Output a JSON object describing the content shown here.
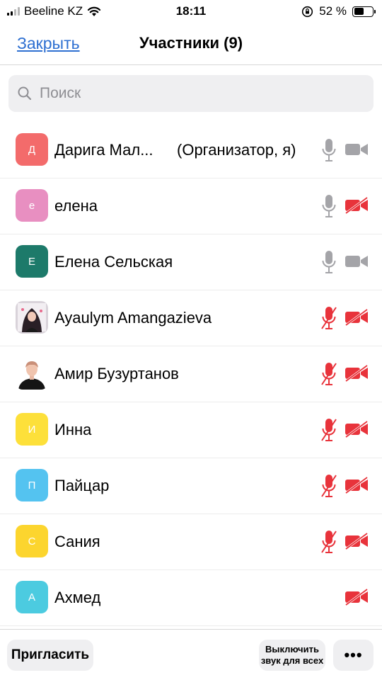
{
  "status_bar": {
    "carrier": "Beeline KZ",
    "time": "18:11",
    "battery": "52 %",
    "battery_level": 0.52
  },
  "nav": {
    "close_label": "Закрыть",
    "title": "Участники (9)"
  },
  "search": {
    "placeholder": "Поиск"
  },
  "colors": {
    "accent": "#2d6fd1",
    "muted_red": "#e8333b",
    "icon_gray": "#a4a4a8"
  },
  "participants": [
    {
      "initial": "Д",
      "name": "Дарига Мал...",
      "role": "(Организатор, я)",
      "avatar_color": "#f36b6b",
      "mic": "on",
      "video": "on"
    },
    {
      "initial": "е",
      "name": "елена",
      "role": "",
      "avatar_color": "#e88fc1",
      "mic": "on",
      "video": "off"
    },
    {
      "initial": "Е",
      "name": "Елена Сельская",
      "role": "",
      "avatar_color": "#1d7a6a",
      "mic": "on",
      "video": "on"
    },
    {
      "initial": "",
      "name": "Ayaulym Amangazieva",
      "role": "",
      "avatar_color": "photo",
      "mic": "off",
      "video": "off"
    },
    {
      "initial": "",
      "name": "Амир Бузуртанов",
      "role": "",
      "avatar_color": "photo",
      "mic": "off",
      "video": "off"
    },
    {
      "initial": "И",
      "name": "Инна",
      "role": "",
      "avatar_color": "#fde03a",
      "mic": "off",
      "video": "off"
    },
    {
      "initial": "П",
      "name": "Пайцар",
      "role": "",
      "avatar_color": "#54c3f0",
      "mic": "off",
      "video": "off"
    },
    {
      "initial": "С",
      "name": "Сания",
      "role": "",
      "avatar_color": "#fcd52e",
      "mic": "off",
      "video": "off"
    },
    {
      "initial": "А",
      "name": "Ахмед",
      "role": "",
      "avatar_color": "#4ccbe0",
      "mic": "none",
      "video": "off"
    }
  ],
  "toolbar": {
    "invite_label": "Пригласить",
    "mute_all_line1": "Выключить",
    "mute_all_line2": "звук для всех",
    "more_label": "•••"
  },
  "icons": {
    "wifi": "wifi-icon",
    "orientation_lock": "orientation-lock-icon",
    "search": "search-icon",
    "mic_on": "microphone-icon",
    "mic_off": "microphone-muted-icon",
    "video_on": "video-camera-icon",
    "video_off": "video-camera-off-icon"
  }
}
